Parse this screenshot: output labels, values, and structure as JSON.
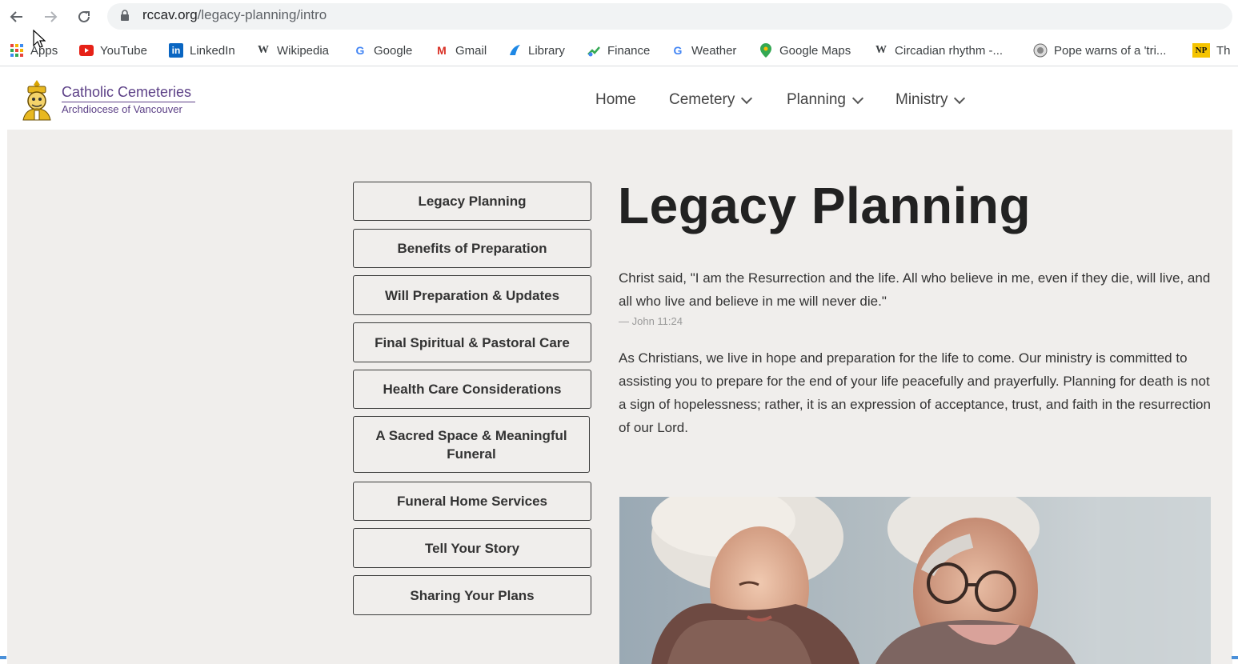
{
  "browser": {
    "url_host": "rccav.org",
    "url_path": "/legacy-planning/intro",
    "bookmarks": [
      {
        "label": "Apps",
        "icon": "apps-grid-icon"
      },
      {
        "label": "YouTube",
        "icon": "youtube-icon"
      },
      {
        "label": "LinkedIn",
        "icon": "linkedin-icon"
      },
      {
        "label": "Wikipedia",
        "icon": "wikipedia-icon"
      },
      {
        "label": "Google",
        "icon": "google-icon"
      },
      {
        "label": "Gmail",
        "icon": "gmail-icon"
      },
      {
        "label": "Library",
        "icon": "library-icon"
      },
      {
        "label": "Finance",
        "icon": "finance-icon"
      },
      {
        "label": "Weather",
        "icon": "google-icon"
      },
      {
        "label": "Google Maps",
        "icon": "maps-pin-icon"
      },
      {
        "label": "Circadian rhythm -...",
        "icon": "wikipedia-icon"
      },
      {
        "label": "Pope warns of a 'tri...",
        "icon": "news-icon"
      },
      {
        "label": "Th",
        "icon": "np-icon",
        "badge": "NP"
      }
    ]
  },
  "site": {
    "brand_name": "Catholic Cemeteries",
    "brand_sub": "Archdiocese of Vancouver",
    "menu": [
      {
        "label": "Home",
        "has_dropdown": false
      },
      {
        "label": "Cemetery",
        "has_dropdown": true
      },
      {
        "label": "Planning",
        "has_dropdown": true
      },
      {
        "label": "Ministry",
        "has_dropdown": true
      }
    ]
  },
  "sidebar": [
    {
      "label": "Legacy Planning"
    },
    {
      "label": "Benefits of Preparation"
    },
    {
      "label": "Will Preparation & Updates"
    },
    {
      "label": "Final Spiritual & Pastoral Care"
    },
    {
      "label": "Health Care Considerations"
    },
    {
      "label": "A Sacred Space & Meaningful Funeral"
    },
    {
      "label": "Funeral Home Services"
    },
    {
      "label": "Tell Your Story"
    },
    {
      "label": "Sharing Your Plans"
    }
  ],
  "main": {
    "title": "Legacy Planning",
    "quote": "Christ said, \"I am the Resurrection and the life. All who believe in me, even if they die, will live, and all who live and believe in me will never die.\"",
    "citation": "— John 11:24",
    "body": "As Christians, we live in hope and preparation for the life to come. Our ministry is committed to assisting you to prepare for the end of your life peacefully and prayerfully. Planning for death is not a sign of hopelessness; rather, it is an expression of acceptance, trust, and faith in the resurrection of our Lord."
  },
  "colors": {
    "brand_purple": "#5b3f86",
    "content_bg": "#f0eeec"
  }
}
